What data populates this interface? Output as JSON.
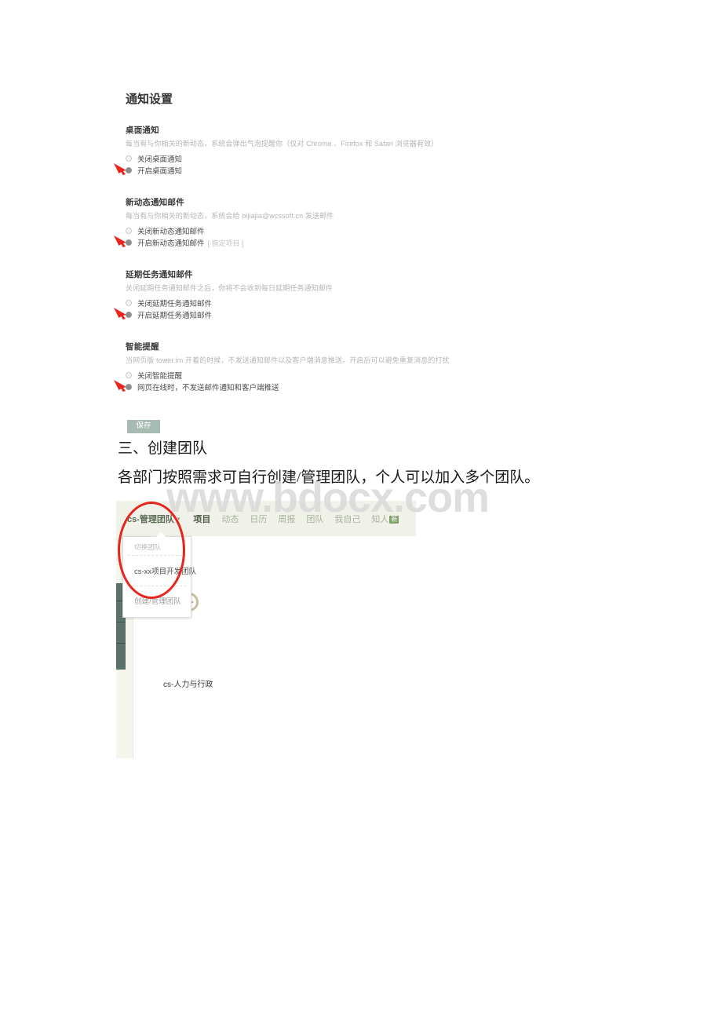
{
  "settings_panel": {
    "title": "通知设置",
    "save_label": "保存",
    "sections": [
      {
        "heading": "桌面通知",
        "description": "每当有与你相关的新动态，系统会弹出气泡提醒你（仅对 Chrome 、Firefox 和 Safari 浏览器有效）",
        "options": [
          {
            "label": "关闭桌面通知",
            "selected": false,
            "arrow": false,
            "sub": ""
          },
          {
            "label": "开启桌面通知",
            "selected": true,
            "arrow": true,
            "sub": ""
          }
        ]
      },
      {
        "heading": "新动态通知邮件",
        "description": "每当有与你相关的新动态，系统会给 bijiajia@wcssoft.cn 发送邮件",
        "options": [
          {
            "label": "关闭新动态通知邮件",
            "selected": false,
            "arrow": false,
            "sub": ""
          },
          {
            "label": "开启新动态通知邮件",
            "selected": true,
            "arrow": true,
            "sub": "[ 指定项目 ]"
          }
        ]
      },
      {
        "heading": "延期任务通知邮件",
        "description": "关闭延期任务通知邮件之后，你将不会收到每日延期任务通知邮件",
        "options": [
          {
            "label": "关闭延期任务通知邮件",
            "selected": false,
            "arrow": false,
            "sub": ""
          },
          {
            "label": "开启延期任务通知邮件",
            "selected": true,
            "arrow": true,
            "sub": ""
          }
        ]
      },
      {
        "heading": "智能提醒",
        "description": "当网页版 tower.im 开着的时候，不发送通知邮件以及客户端消息推送。开启后可以避免重复消息的打扰",
        "options": [
          {
            "label": "关闭智能提醒",
            "selected": false,
            "arrow": false,
            "sub": ""
          },
          {
            "label": "网页在线时，不发送邮件通知和客户端推送",
            "selected": true,
            "arrow": true,
            "sub": ""
          }
        ]
      }
    ]
  },
  "document": {
    "heading": "三、创建团队",
    "paragraph": "各部门按照需求可自行创建/管理团队，个人可以加入多个团队。"
  },
  "watermark": {
    "text": "www.bdocx.com"
  },
  "app": {
    "team_switcher": {
      "label": "cs-管理团队",
      "caret": "▾"
    },
    "nav_items": [
      {
        "label": "项目",
        "active": true,
        "badge": ""
      },
      {
        "label": "动态",
        "active": false,
        "badge": ""
      },
      {
        "label": "日历",
        "active": false,
        "badge": ""
      },
      {
        "label": "周报",
        "active": false,
        "badge": ""
      },
      {
        "label": "团队",
        "active": false,
        "badge": ""
      },
      {
        "label": "我自己",
        "active": false,
        "badge": ""
      },
      {
        "label": "知人",
        "active": false,
        "badge": "新"
      }
    ],
    "dropdown": {
      "section_label": "切换团队",
      "items": [
        "cs-xx项目开发团队"
      ],
      "footer_item": "创建/管理团队"
    },
    "content": {
      "team_name": "cs-人力与行政"
    }
  },
  "colors": {
    "navbar_bg": "#f0f2e9",
    "nav_active": "#4a5a46",
    "nav_inactive": "#a8b39e",
    "badge_green": "#7fa06a",
    "sidebar_teal": "#5b7268",
    "save_button": "#a8bbb2",
    "annotation_red": "#e8241c",
    "clock_icon": "#c9bf9e",
    "watermark_gray": "#d9d9d9"
  }
}
